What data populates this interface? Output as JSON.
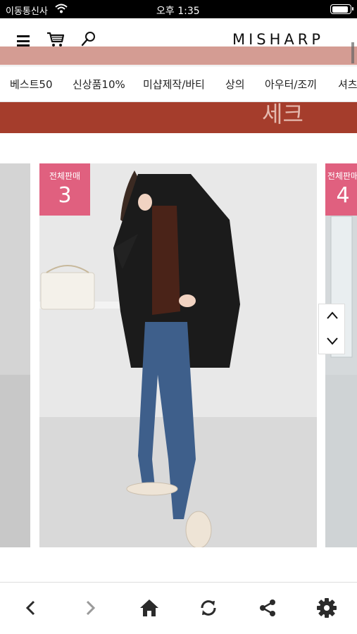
{
  "status_bar": {
    "carrier": "이동통신사",
    "time": "오후 1:35",
    "battery_level": 0.9
  },
  "header": {
    "logo": "MISHARP"
  },
  "categories": [
    "베스트50",
    "신상품10%",
    "미샵제작/바티",
    "상의",
    "아우터/조끼",
    "셔츠"
  ],
  "banner": {
    "text": "세크"
  },
  "carousel": {
    "slides": [
      {
        "rank_label": "전체판매",
        "rank": "3"
      },
      {
        "rank_label": "전체판매",
        "rank": "4"
      }
    ]
  },
  "colors": {
    "badge": "#e0607f",
    "banner": "#a53d2c",
    "toolbar_icon": "#2b2b2b",
    "toolbar_icon_disabled": "#9a9a9a"
  },
  "toolbar": {
    "items": [
      {
        "icon": "back-icon"
      },
      {
        "icon": "forward-icon"
      },
      {
        "icon": "home-icon"
      },
      {
        "icon": "refresh-icon"
      },
      {
        "icon": "share-icon"
      },
      {
        "icon": "settings-icon"
      }
    ]
  }
}
